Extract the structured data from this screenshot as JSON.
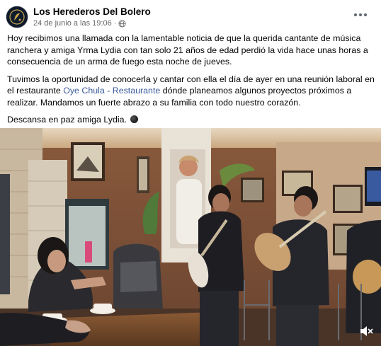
{
  "page": {
    "name": "Los Herederos Del Bolero",
    "date": "24 de junio a las 19:06",
    "dot": "·"
  },
  "icons": {
    "avatar": "band-logo-avatar",
    "privacy": "globe-icon",
    "menu": "more-options-icon",
    "reaction": "new-moon-emoji",
    "sound": "volume-muted-icon"
  },
  "post": {
    "paragraph1": "Hoy recibimos una llamada con la lamentable noticia de que la querida cantante de música ranchera y amiga Yrma Lydia con tan solo 21 años de edad perdió la vida hace unas horas a consecuencia de un arma de fuego esta noche de jueves.",
    "paragraph2_before": "Tuvimos la oportunidad de conocerla y cantar con ella el día de ayer en una reunión laboral en el restaurante ",
    "paragraph2_link": "Oye Chula - Restaurante",
    "paragraph2_after": " dónde planeamos algunos proyectos próximos a realizar. Mandamos un fuerte abrazo a su familia con todo nuestro corazón.",
    "paragraph3": "Descansa en paz amiga Lydia."
  },
  "colors": {
    "link": "#385898",
    "meta": "#65676b",
    "text": "#050505"
  }
}
